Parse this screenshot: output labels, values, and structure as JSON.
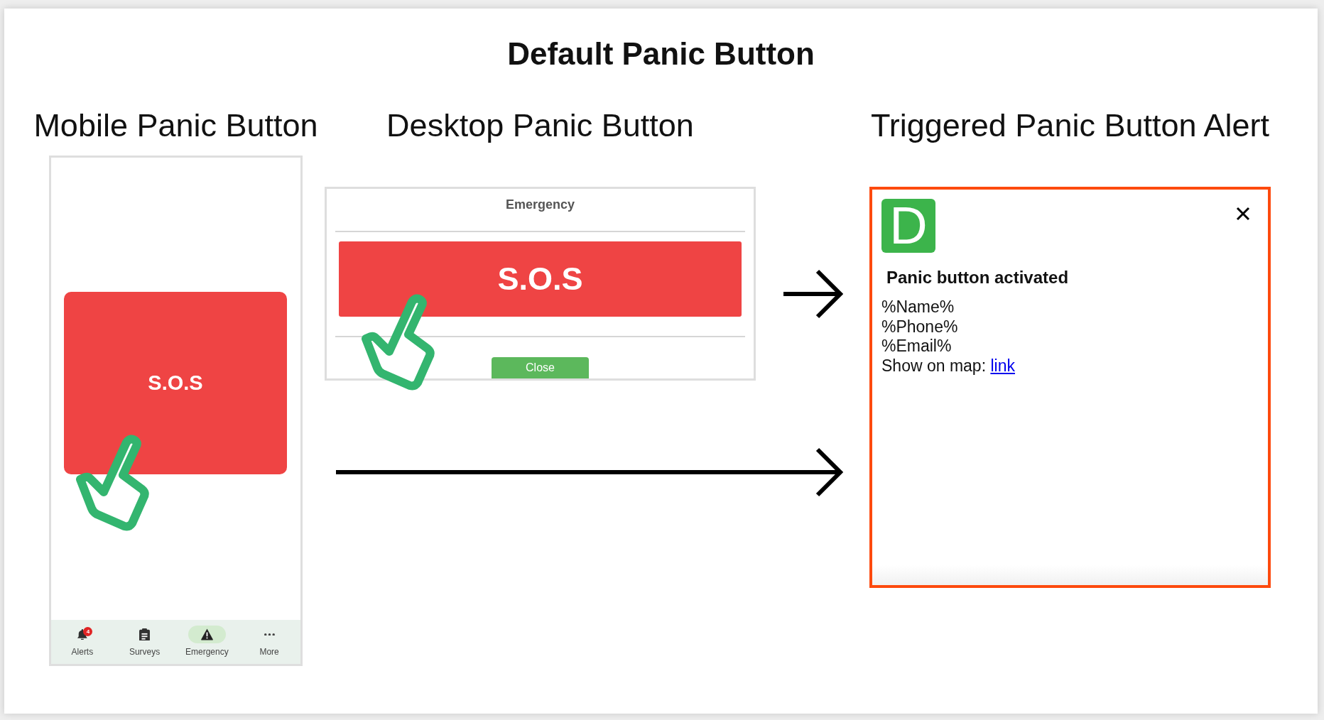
{
  "title": "Default Panic Button",
  "mobile": {
    "heading": "Mobile Panic Button",
    "sos_button": "S.O.S",
    "bottom_nav": [
      {
        "label": "Alerts",
        "badge": "4",
        "selected": false
      },
      {
        "label": "Surveys",
        "selected": false
      },
      {
        "label": "Emergency",
        "selected": true
      },
      {
        "label": "More",
        "selected": false
      }
    ]
  },
  "desktop": {
    "heading": "Desktop Panic Button",
    "dialog_title": "Emergency",
    "sos_button": "S.O.S",
    "close_button": "Close"
  },
  "alert": {
    "heading": "Triggered Panic Button Alert",
    "logo": "D",
    "title": "Panic button activated",
    "lines": [
      "%Name%",
      "%Phone%",
      "%Email%"
    ],
    "map_label": "Show on map:",
    "map_link": "link"
  }
}
